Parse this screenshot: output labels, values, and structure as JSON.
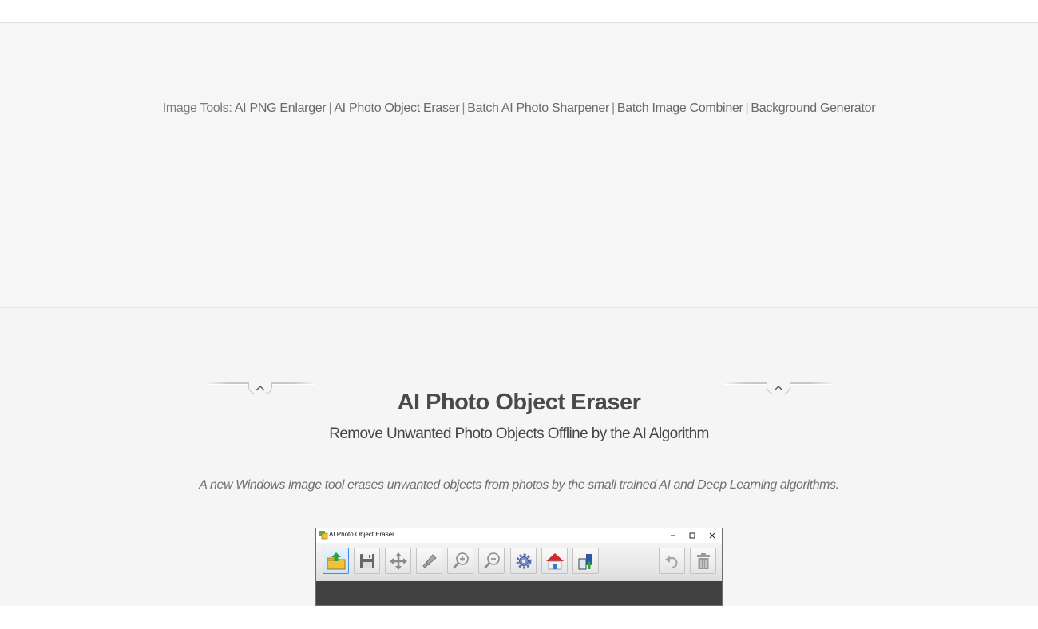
{
  "tools_nav": {
    "prefix": "Image Tools:",
    "separator": "|",
    "links": [
      {
        "label": "AI PNG Enlarger"
      },
      {
        "label": "AI Photo Object Eraser"
      },
      {
        "label": "Batch AI Photo Sharpener"
      },
      {
        "label": "Batch Image Combiner"
      },
      {
        "label": "Background Generator"
      }
    ]
  },
  "product": {
    "title": "AI Photo Object Eraser",
    "subtitle": "Remove Unwanted Photo Objects Offline by the AI Algorithm",
    "description": "A new Windows image tool erases unwanted objects from photos by the small trained AI and Deep Learning algorithms."
  },
  "app_window": {
    "title": "AI Photo Object Eraser",
    "toolbar_icons": [
      "open-image-icon",
      "save-icon",
      "move-icon",
      "eraser-brush-icon",
      "zoom-in-icon",
      "zoom-out-icon",
      "settings-gear-icon",
      "home-icon",
      "batch-process-icon",
      "undo-icon",
      "trash-icon"
    ]
  },
  "colors": {
    "section_background": "#f5f5f5",
    "link_text": "#6a6a6a",
    "title_text": "#4a4a4a",
    "canvas_background": "#404040"
  }
}
